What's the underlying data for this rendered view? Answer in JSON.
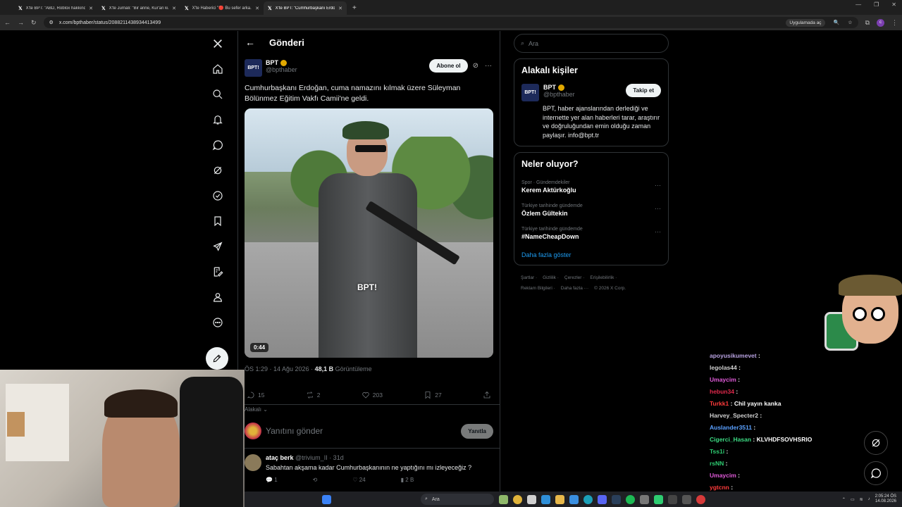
{
  "browser": {
    "tabs": [
      {
        "title": "X'te BPT: \"ABD, Roblox hakkında...",
        "active": false
      },
      {
        "title": "X'te Jurnali: \"Bir anne, Kur'an ku...",
        "active": false
      },
      {
        "title": "X'te Haberici \"🔴 Bu sefer arka...",
        "active": false
      },
      {
        "title": "X'te BPT: \"Cumhurbaşkanı Erdo...",
        "active": true
      }
    ],
    "new_tab": "+",
    "url": "x.com/bpthaber/status/2088211438934413499",
    "app_button": "Uygulamada aç",
    "profile_initial": "c"
  },
  "nav": {
    "icons": [
      "x-logo",
      "home-icon",
      "search-icon",
      "bell-icon",
      "message-icon",
      "grok-icon",
      "verified-icon",
      "bookmark-icon",
      "rocket-icon",
      "edit-doc-icon",
      "profile-icon",
      "more-icon"
    ]
  },
  "post_header": {
    "title": "Gönderi"
  },
  "post": {
    "author_logo": "BPT!",
    "author_name": "BPT",
    "author_handle": "@bpthaber",
    "follow_label": "Abone ol",
    "text": "Cumhurbaşkanı Erdoğan, cuma namazını kılmak üzere Süleyman Bölünmez Eğitim Vakfı Camii'ne geldi.",
    "video_duration": "0:44",
    "video_watermark": "BPT!",
    "time": "ÖS 1:29 · 14 Ağu 2026 · ",
    "views_count": "48,1 B",
    "views_label": "Görüntüleme",
    "replies": "15",
    "reposts": "2",
    "likes": "203",
    "bookmarks": "27",
    "relevance": "Alakalı"
  },
  "reply_box": {
    "placeholder": "Yanıtını gönder",
    "button": "Yanıtla"
  },
  "comment": {
    "name": "ataç berk",
    "handle": "@trivium_II · 31d",
    "text": "Sabahtan akşama kadar Cumhurbaşkanının ne yaptığını mı izleyeceğiz ?",
    "replies": "1",
    "likes": "24",
    "views": "2 B"
  },
  "sidebar": {
    "search_placeholder": "Ara",
    "related_title": "Alakalı kişiler",
    "related": {
      "name": "BPT",
      "handle": "@bpthaber",
      "button": "Takip et",
      "bio": "BPT, haber ajanslarından derlediği ve internette yer alan haberleri tarar, araştırır ve doğruluğundan emin olduğu zaman paylaşır. info@bpt.tr"
    },
    "trends_title": "Neler oluyor?",
    "trends": [
      {
        "category": "Spor · Gündemdekiler",
        "name": "Kerem Aktürkoğlu"
      },
      {
        "category": "Türkiye tarihinde gündemde",
        "name": "Özlem Gültekin"
      },
      {
        "category": "Türkiye tarihinde gündemde",
        "name": "#NameCheapDown"
      }
    ],
    "show_more": "Daha fazla göster",
    "footer": [
      "Şartlar ·",
      "Gizlilik ·",
      "Çerezler ·",
      "Erişilebilirlik ·",
      "Reklam Bilgileri ·",
      "Daha fazla ···",
      "© 2026 X Corp."
    ]
  },
  "stream_chat": [
    {
      "user": "apoyusikumevet",
      "text": "",
      "color": "#b8a2e0"
    },
    {
      "user": "legolas44",
      "text": "",
      "color": "#d1d1d1"
    },
    {
      "user": "Umaycim",
      "text": "",
      "color": "#e05ad8"
    },
    {
      "user": "hebun34",
      "text": "",
      "color": "#e0294c"
    },
    {
      "user": "Turkk1",
      "text": "Chil yayın kanka",
      "color": "#ff3b3b"
    },
    {
      "user": "Harvey_Specter2",
      "text": "",
      "color": "#d1d1d1"
    },
    {
      "user": "Auslander3511",
      "text": "",
      "color": "#5aa0ff"
    },
    {
      "user": "Cigerci_Hasan",
      "text": "KLVHDFSOVHSRIO",
      "color": "#3ddc84"
    },
    {
      "user": "Tss1i",
      "text": "",
      "color": "#2ecc71"
    },
    {
      "user": "rsNN",
      "text": "",
      "color": "#2ecc71"
    },
    {
      "user": "Umaycim",
      "text": "",
      "color": "#e05ad8"
    },
    {
      "user": "ygtcnn",
      "text": "",
      "color": "#ff3b3b"
    }
  ],
  "taskbar": {
    "search": "Ara",
    "time": "2:05:24 ÖS",
    "date": "14.08.2026"
  },
  "colors": {
    "accent": "#1d9bf0",
    "verified": "#e1a800"
  }
}
